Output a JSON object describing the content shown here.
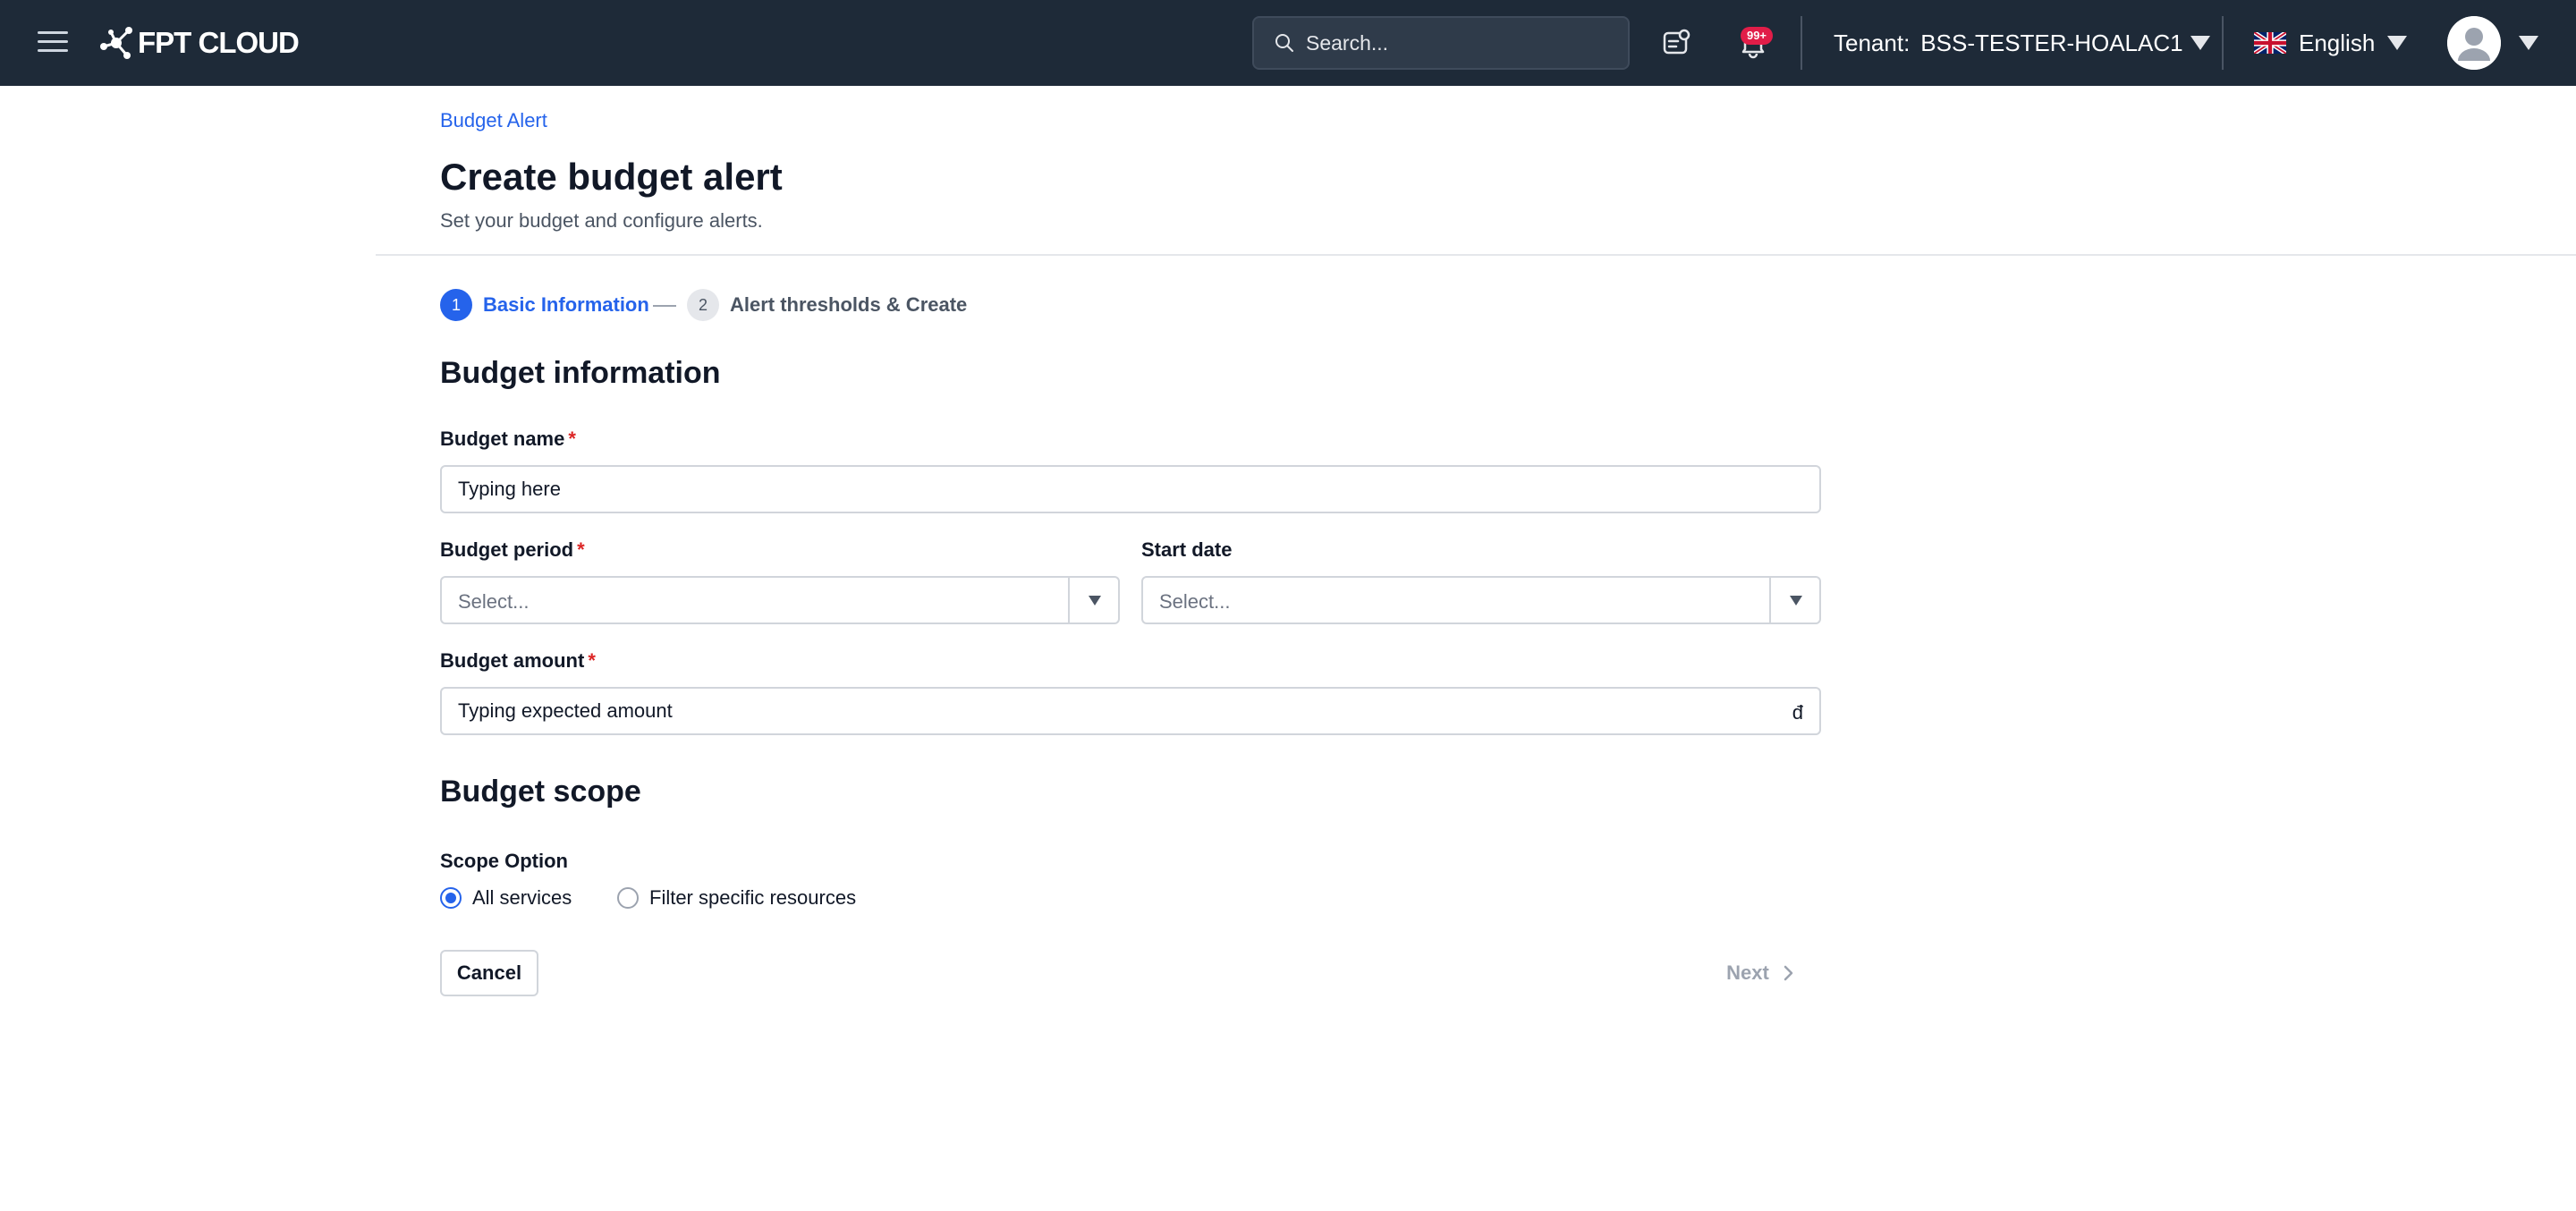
{
  "app": {
    "logo_text": "FPT CLOUD"
  },
  "header": {
    "search_placeholder": "Search...",
    "notification_badge": "99+",
    "tenant_label": "Tenant:",
    "tenant_value": "BSS-TESTER-HOALAC1",
    "language": "English"
  },
  "page": {
    "breadcrumb": "Budget Alert",
    "title": "Create budget alert",
    "subtitle": "Set your budget and configure alerts."
  },
  "stepper": {
    "steps": [
      {
        "number": "1",
        "label": "Basic Information",
        "state": "active"
      },
      {
        "number": "2",
        "label": "Alert thresholds & Create",
        "state": "inactive"
      }
    ]
  },
  "form": {
    "budget_info_title": "Budget information",
    "budget_name": {
      "label": "Budget name",
      "required": "*",
      "placeholder": "Typing here"
    },
    "budget_period": {
      "label": "Budget period",
      "required": "*",
      "placeholder": "Select..."
    },
    "start_date": {
      "label": "Start date",
      "placeholder": "Select..."
    },
    "budget_amount": {
      "label": "Budget amount",
      "required": "*",
      "placeholder": "Typing expected amount",
      "currency": "đ"
    },
    "scope_title": "Budget scope",
    "scope_option": {
      "label": "Scope Option",
      "options": [
        {
          "label": "All services",
          "selected": true
        },
        {
          "label": "Filter specific resources",
          "selected": false
        }
      ]
    }
  },
  "actions": {
    "cancel_label": "Cancel",
    "next_label": "Next"
  },
  "colors": {
    "topbar": "#1e2a38",
    "accent": "#2563eb",
    "required": "#dc2626",
    "badge": "#e11d48"
  }
}
